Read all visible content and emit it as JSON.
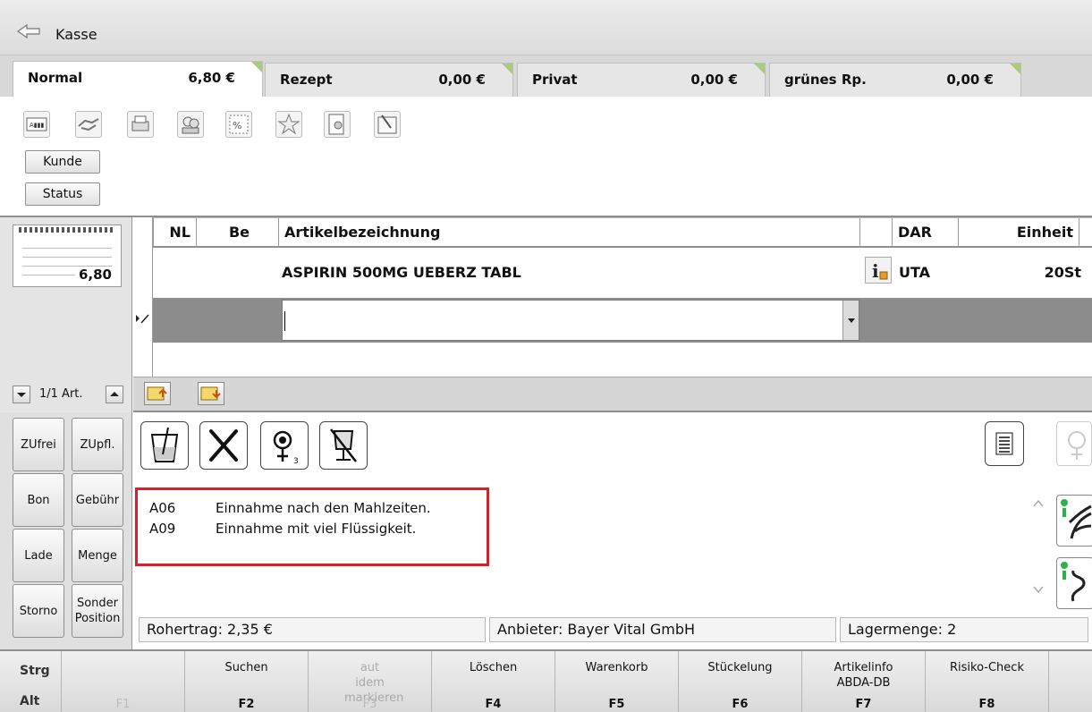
{
  "window": {
    "title": "Kasse"
  },
  "tabs": [
    {
      "name": "Normal",
      "amount": "6,80 €",
      "active": true
    },
    {
      "name": "Rezept",
      "amount": "0,00 €",
      "active": false
    },
    {
      "name": "Privat",
      "amount": "0,00 €",
      "active": false
    },
    {
      "name": "grünes Rp.",
      "amount": "0,00 €",
      "active": false
    }
  ],
  "toolbar": {
    "icons": [
      "card-reader-icon",
      "handshake-icon",
      "printer-icon",
      "customer-icon",
      "discount-icon",
      "special-icon",
      "document-person-icon",
      "pin-board-icon"
    ],
    "kunde_label": "Kunde",
    "status_label": "Status"
  },
  "receipt": {
    "total": "6,80"
  },
  "pager": {
    "label": "1/1 Art."
  },
  "grid": {
    "headers": {
      "nl": "NL",
      "be": "Be",
      "artikel": "Artikelbezeichnung",
      "dar": "DAR",
      "einheit": "Einheit"
    },
    "rows": [
      {
        "nl": "",
        "be": "",
        "artikel": "ASPIRIN 500MG UEBERZ TABL",
        "dar": "UTA",
        "einheit": "20St"
      }
    ],
    "input_value": ""
  },
  "quick_buttons": [
    "ZUfrei",
    "ZUpfl.",
    "Bon",
    "Gebühr",
    "Lade",
    "Menge",
    "Storno",
    "Sonder Position"
  ],
  "hints": [
    {
      "code": "A06",
      "text": "Einnahme nach den Mahlzeiten."
    },
    {
      "code": "A09",
      "text": "Einnahme mit viel Flüssigkeit."
    }
  ],
  "info_icon_badge": "3",
  "status": {
    "rohertrag": "Rohertrag: 2,35 €",
    "anbieter": "Anbieter: Bayer Vital GmbH",
    "lagermenge": "Lagermenge: 2"
  },
  "modifiers": {
    "strg": "Strg",
    "alt": "Alt"
  },
  "fkeys": [
    {
      "label": "",
      "code": "F1",
      "disabled": true
    },
    {
      "label": "Suchen",
      "code": "F2",
      "disabled": false
    },
    {
      "label": "aut idem markieren",
      "code": "F3",
      "disabled": true
    },
    {
      "label": "Löschen",
      "code": "F4",
      "disabled": false
    },
    {
      "label": "Warenkorb",
      "code": "F5",
      "disabled": false
    },
    {
      "label": "Stückelung",
      "code": "F6",
      "disabled": false
    },
    {
      "label": "Artikelinfo ABDA-DB",
      "code": "F7",
      "disabled": false
    },
    {
      "label": "Risiko-Check",
      "code": "F8",
      "disabled": false
    }
  ]
}
